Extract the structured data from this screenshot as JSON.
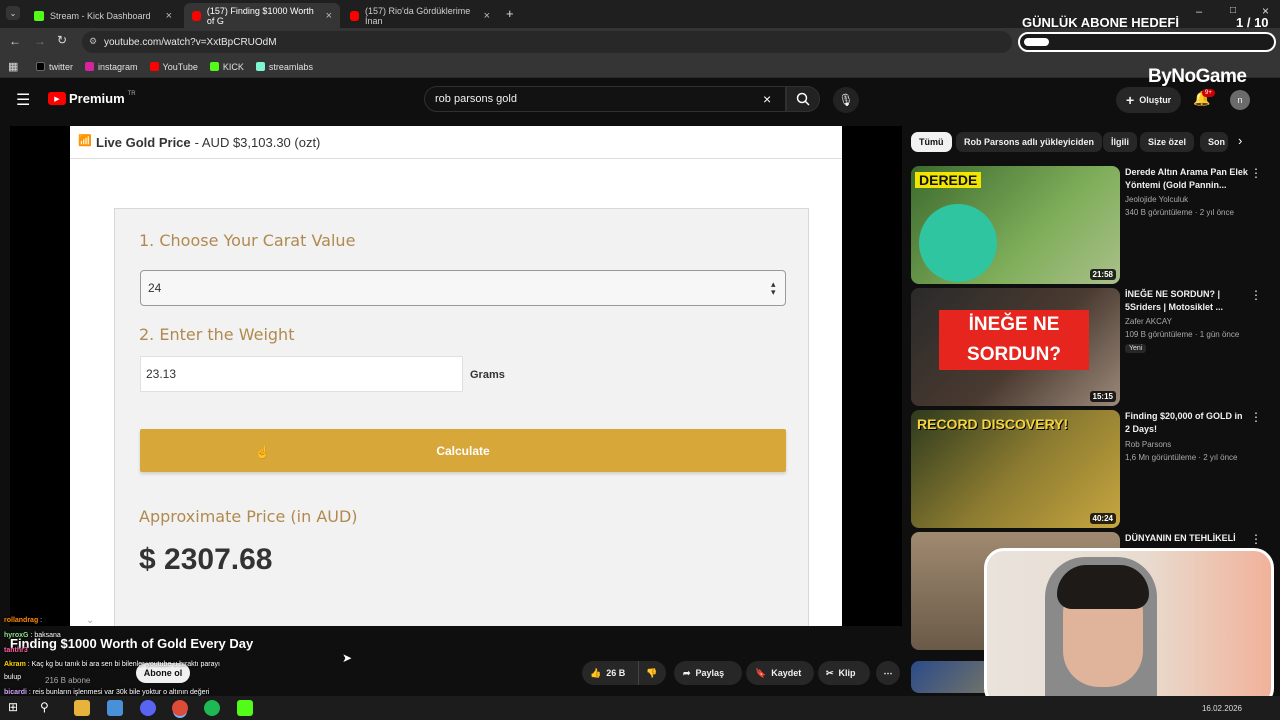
{
  "browser": {
    "tabs": [
      {
        "label": "Stream - Kick Dashboard",
        "icon": "kick-icon"
      },
      {
        "label": "(157) Finding $1000 Worth of G",
        "icon": "youtube-icon"
      },
      {
        "label": "(157) Rio'da Gördüklerime İnan",
        "icon": "youtube-icon"
      }
    ],
    "url": "youtube.com/watch?v=XxtBpCRUOdM",
    "bookmarks": [
      {
        "label": "twitter",
        "color": "#000000"
      },
      {
        "label": "instagram",
        "color": "#d6249f"
      },
      {
        "label": "YouTube",
        "color": "#ff0000"
      },
      {
        "label": "KICK",
        "color": "#53fc18"
      },
      {
        "label": "streamlabs",
        "color": "#80f5d2"
      }
    ]
  },
  "youtube": {
    "logo_text": "Premium",
    "region": "TR",
    "search_value": "rob parsons gold",
    "create_label": "Oluştur",
    "notif_count": "9+",
    "avatar_letter": "n"
  },
  "webpage": {
    "header_bold": "Live Gold Price",
    "header_rest": " - AUD $3,103.30 (ozt)",
    "step1": "1. Choose Your Carat Value",
    "carat_value": "24",
    "step2": "2. Enter the Weight",
    "weight_value": "23.13",
    "weight_unit": "Grams",
    "calc_label": "Calculate",
    "approx_label": "Approximate Price (in AUD)",
    "price": "$ 2307.68"
  },
  "video": {
    "title": "Finding $1000 Worth of Gold Every Day",
    "subscribers": "216 B abone",
    "subscribe_label": "Abone ol",
    "likes": "26 B",
    "share_label": "Paylaş",
    "save_label": "Kaydet",
    "clip_label": "Klip"
  },
  "chat": [
    {
      "user": "rollandrag",
      "text": " :"
    },
    {
      "user": "hyroxG",
      "text": " : baksana"
    },
    {
      "user": "tanthr3",
      "text": ""
    },
    {
      "user": "Akram",
      "text": " : Kaç kg bu tanık bi ara sen bi bilenler youtube u bıraktı parayı"
    },
    {
      "user": "",
      "text": "bulup"
    },
    {
      "user": "bicardi",
      "text": " : reis bunların işlenmesi var 30k bile yoktur o altının değeri"
    }
  ],
  "sidebar": {
    "chips": [
      "Tümü",
      "Rob Parsons adlı yükleyiciden",
      "İlgili",
      "Size özel",
      "Son"
    ],
    "videos": [
      {
        "title": "Derede Altın Arama Pan Elek Yöntemi (Gold Pannin...",
        "channel": "Jeolojide Yolculuk",
        "meta": "340 B görüntüleme · 2 yıl önce",
        "duration": "21:58",
        "thumb_text": "DEREDE"
      },
      {
        "title": "İNEĞE NE SORDUN? | 5Sriders | Motosiklet ...",
        "channel": "Zafer AKCAY",
        "meta": "109 B görüntüleme · 1 gün önce",
        "badge": "Yeni",
        "duration": "15:15",
        "thumb_text": "İNEĞE NE SORDUN?"
      },
      {
        "title": "Finding $20,000 of GOLD in 2 Days!",
        "channel": "Rob Parsons",
        "meta": "1,6 Mn görüntüleme · 2 yıl önce",
        "duration": "40:24",
        "thumb_text": "RECORD DISCOVERY!"
      },
      {
        "title": "DÜNYANIN EN TEHLİKELİ",
        "channel": "",
        "meta": "",
        "duration": "",
        "thumb_text": ""
      }
    ]
  },
  "overlay": {
    "goal_title": "GÜNLÜK ABONE HEDEFİ",
    "goal_count": "1 / 10",
    "goal_fraction": 0.1,
    "brand": "ByNoGame"
  },
  "taskbar": {
    "date": "16.02.2026"
  }
}
